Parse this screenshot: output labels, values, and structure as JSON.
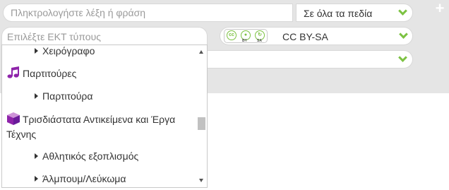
{
  "search": {
    "keyword_placeholder": "Πληκτρολογήστε λέξη ή φράση",
    "field_value": "Σε όλα τα πεδία",
    "add_label": "+"
  },
  "type_filter": {
    "placeholder": "Επιλέξτε ΕΚΤ τύπους",
    "items": [
      {
        "label": "Χειρόγραφο",
        "kind": "child"
      },
      {
        "label": "Παρτιτούρες",
        "kind": "group",
        "icon": "music-note-icon"
      },
      {
        "label": "Παρτιτούρα",
        "kind": "child"
      },
      {
        "label": "Τρισδιάστατα Αντικείμενα και Έργα Τέχνης",
        "kind": "group",
        "icon": "cube-icon"
      },
      {
        "label": "Αθλητικός εξοπλισμός",
        "kind": "child"
      },
      {
        "label": "Άλμπουμ/Λεύκωμα",
        "kind": "child"
      }
    ]
  },
  "license": {
    "value": "CC BY-SA",
    "badge_cc": "cc",
    "badge_by": "BY",
    "badge_sa": "SA"
  },
  "colors": {
    "accent": "#7cc242",
    "icon_purple": "#8e24aa",
    "panel_bg": "#e5e5e5"
  }
}
